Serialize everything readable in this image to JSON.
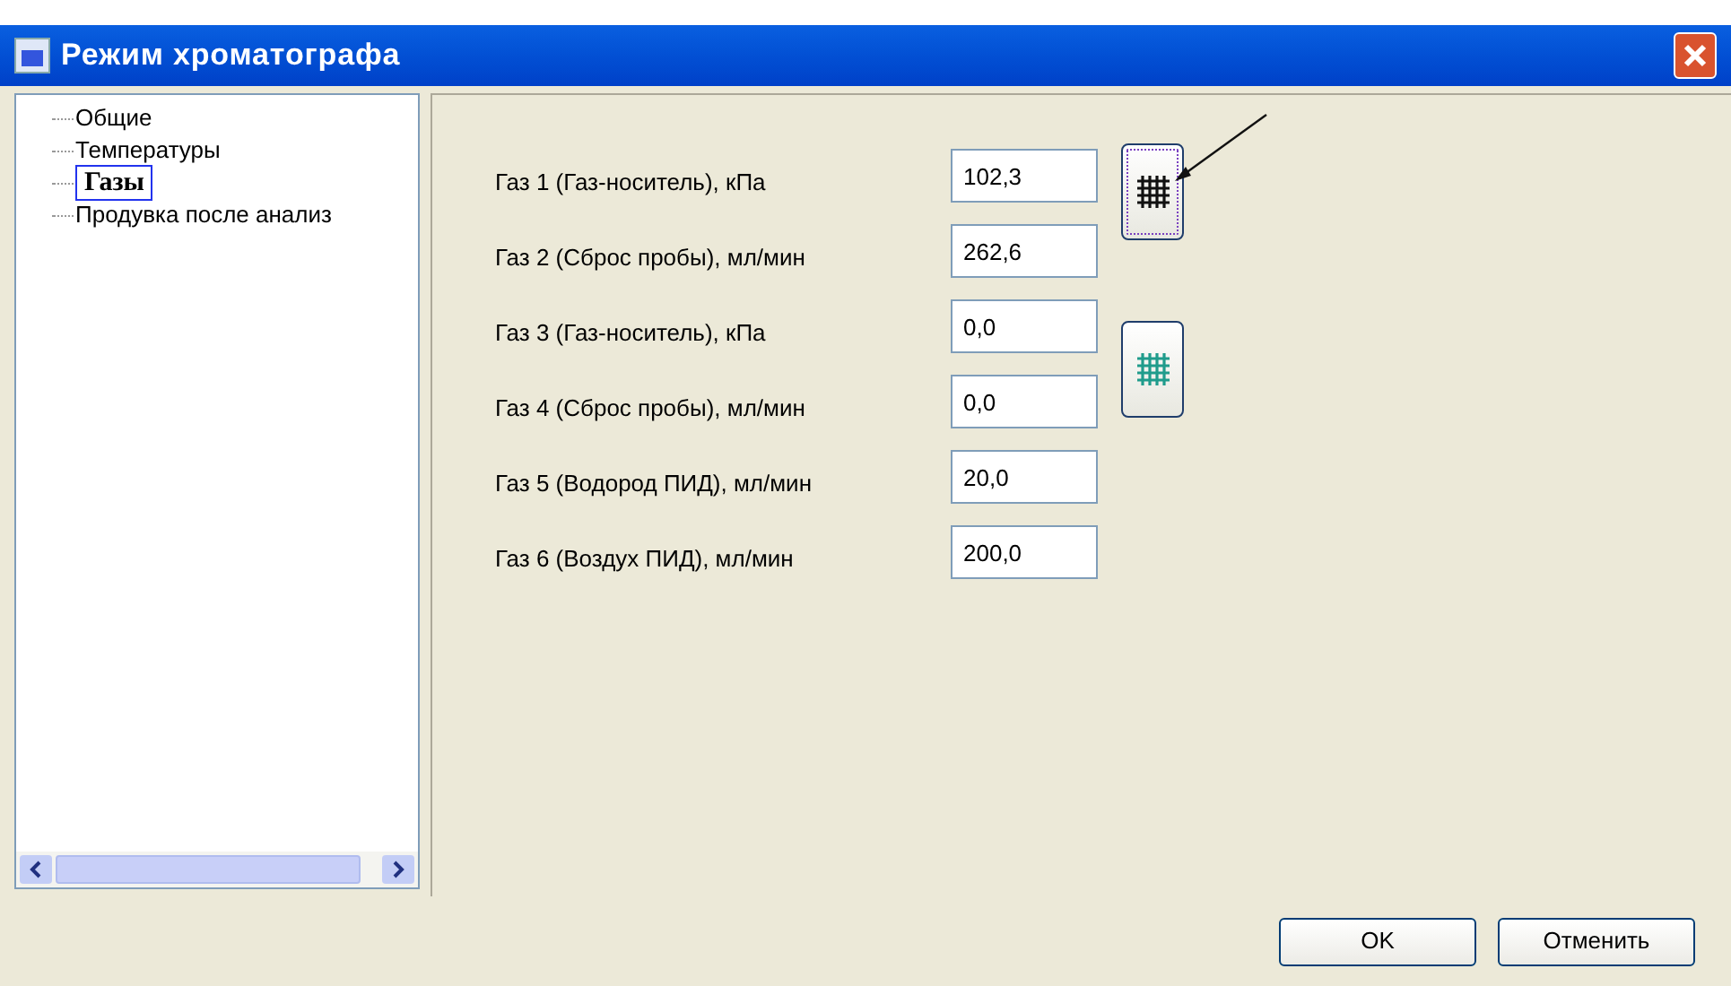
{
  "window": {
    "title": "Режим хроматографа"
  },
  "tree": {
    "items": [
      {
        "label": "Общие",
        "selected": false
      },
      {
        "label": "Температуры",
        "selected": false
      },
      {
        "label": "Газы",
        "selected": true
      },
      {
        "label": "Продувка после анализ",
        "selected": false
      }
    ]
  },
  "fields": [
    {
      "label": "Газ 1 (Газ-носитель), кПа",
      "value": "102,3"
    },
    {
      "label": "Газ 2 (Сброс пробы), мл/мин",
      "value": "262,6"
    },
    {
      "label": "Газ 3 (Газ-носитель), кПа",
      "value": "0,0"
    },
    {
      "label": "Газ 4 (Сброс пробы), мл/мин",
      "value": "0,0"
    },
    {
      "label": "Газ 5 (Водород ПИД), мл/мин",
      "value": "20,0"
    },
    {
      "label": "Газ 6 (Воздух ПИД), мл/мин",
      "value": "200,0"
    }
  ],
  "grid_buttons": [
    {
      "focused": true
    },
    {
      "focused": false
    }
  ],
  "buttons": [
    "OK",
    "Отменить"
  ]
}
